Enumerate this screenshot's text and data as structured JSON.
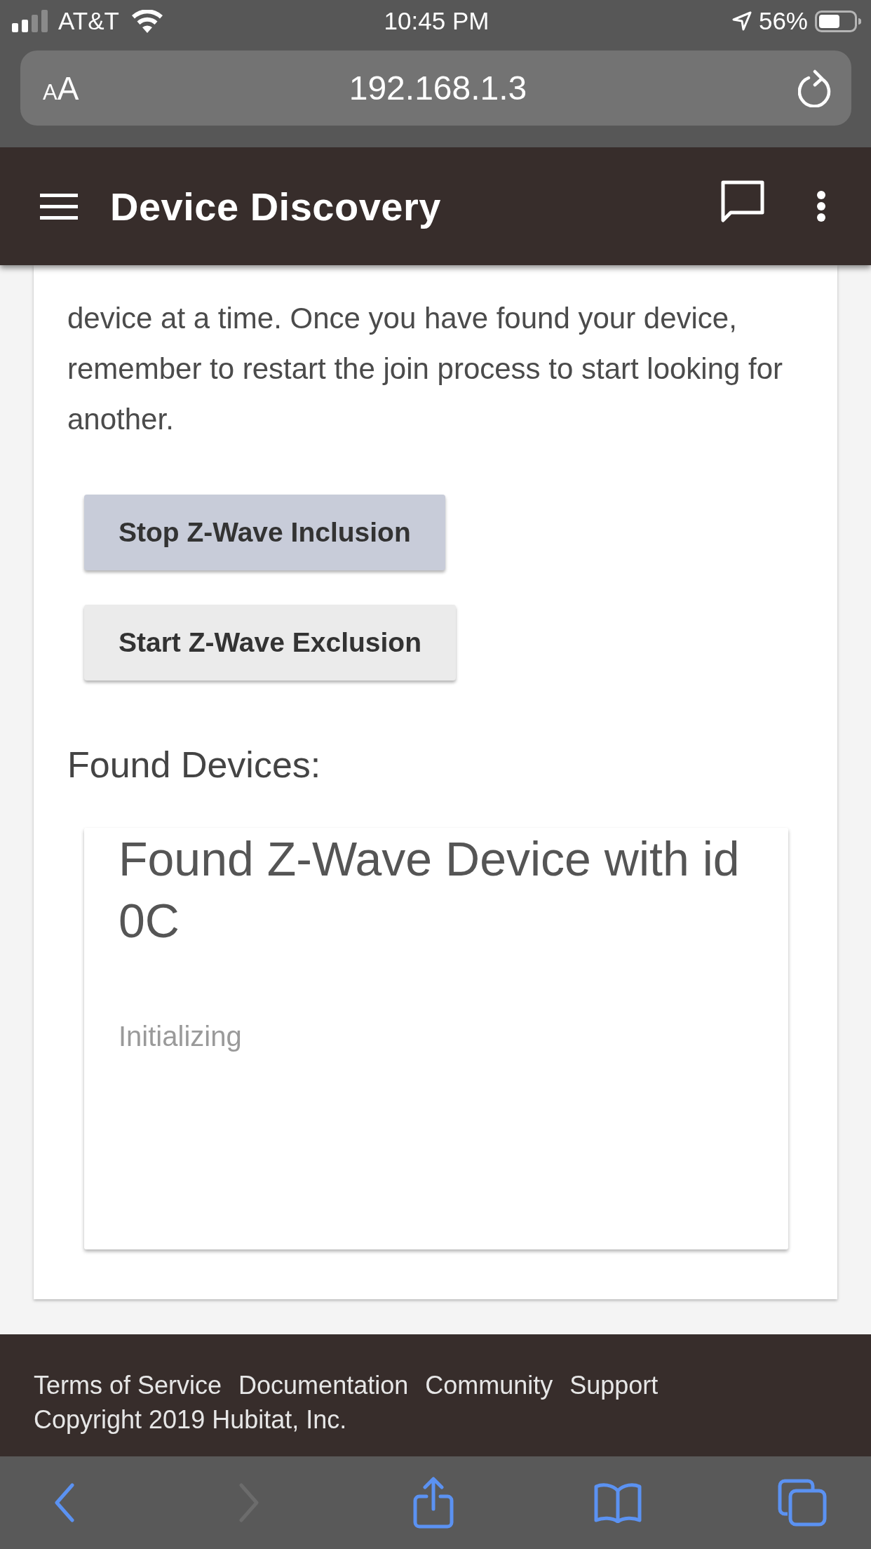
{
  "status_bar": {
    "carrier": "AT&T",
    "time": "10:45 PM",
    "battery_percent": "56%"
  },
  "address_bar": {
    "text_size_button": "AA",
    "url": "192.168.1.3"
  },
  "app_bar": {
    "title": "Device Discovery"
  },
  "intro": "device at a time. Once you have found your device, remember to restart the join process to start looking for another.",
  "actions": [
    {
      "label": "Stop Z-Wave Inclusion",
      "active": true
    },
    {
      "label": "Start Z-Wave Exclusion",
      "active": false
    }
  ],
  "found_devices": {
    "heading": "Found Devices:",
    "devices": [
      {
        "title": "Found Z-Wave Device with id 0C",
        "status": "Initializing"
      }
    ]
  },
  "footer": {
    "links": [
      "Terms of Service",
      "Documentation",
      "Community",
      "Support"
    ],
    "copyright": "Copyright 2019 Hubitat, Inc."
  },
  "browser_toolbar": {
    "buttons": [
      {
        "kind": "back",
        "disabled": false
      },
      {
        "kind": "forward",
        "disabled": true
      },
      {
        "kind": "share",
        "disabled": false
      },
      {
        "kind": "bookmarks",
        "disabled": false
      },
      {
        "kind": "tabs",
        "disabled": false
      }
    ]
  }
}
